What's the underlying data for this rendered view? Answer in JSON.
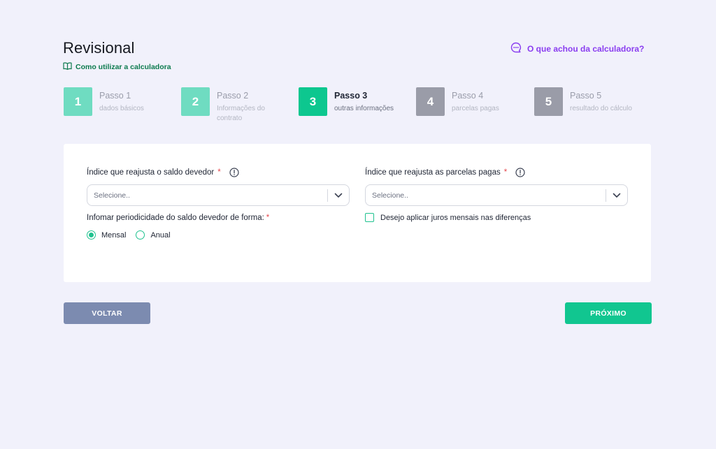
{
  "header": {
    "title": "Revisional",
    "howto_label": "Como utilizar a calculadora",
    "feedback_label": "O que achou da calculadora?"
  },
  "steps": [
    {
      "number": "1",
      "title": "Passo 1",
      "subtitle": "dados básicos",
      "color": "#6fdcc1"
    },
    {
      "number": "2",
      "title": "Passo 2",
      "subtitle": "Informações do contrato",
      "color": "#6fdcc1"
    },
    {
      "number": "3",
      "title": "Passo 3",
      "subtitle": "outras informações",
      "color": "#0dc78f"
    },
    {
      "number": "4",
      "title": "Passo 4",
      "subtitle": "parcelas pagas",
      "color": "#9a9ca8"
    },
    {
      "number": "5",
      "title": "Passo 5",
      "subtitle": "resultado do cálculo",
      "color": "#9a9ca8"
    }
  ],
  "form": {
    "saldo_label": "Índice que reajusta o saldo devedor",
    "saldo_select_value": "Selecione..",
    "parcelas_label": "Índice que reajusta as parcelas pagas",
    "parcelas_select_value": "Selecione..",
    "required_mark": "*",
    "periodicidade_label": "Infomar periodicidade do saldo devedor de forma:",
    "radio_options": [
      {
        "label": "Mensal",
        "selected": true
      },
      {
        "label": "Anual",
        "selected": false
      }
    ],
    "checkbox_label": "Desejo aplicar juros mensais nas diferenças",
    "checkbox_checked": false
  },
  "actions": {
    "back_label": "VOLTAR",
    "next_label": "PRÓXIMO"
  },
  "colors": {
    "accent": "#11c690",
    "back_button": "#7c8bb0",
    "feedback": "#8a3df0",
    "howto": "#0c7a4e",
    "required": "#e5484d"
  }
}
